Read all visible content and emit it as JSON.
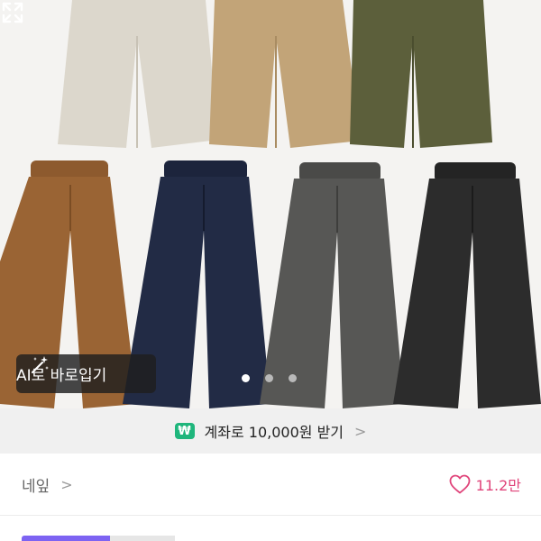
{
  "product_image": {
    "alt_name": "wide-leg-pants-color-options",
    "ai_button": {
      "label": "AI로 바로입기",
      "icon": "magic-wand-icon"
    },
    "carousel": {
      "total": 3,
      "active_index": 0
    },
    "expand_icon": "expand-icon"
  },
  "transfer_bar": {
    "badge": "₩",
    "text": "계좌로 10,000원 받기",
    "chevron": ">"
  },
  "seller": {
    "name": "네잎",
    "chevron": ">"
  },
  "likes": {
    "count": "11.2만",
    "icon": "heart-icon"
  },
  "colors": {
    "accent": "#7d63f2",
    "like": "#e0447a",
    "badge": "#1fb67c"
  }
}
